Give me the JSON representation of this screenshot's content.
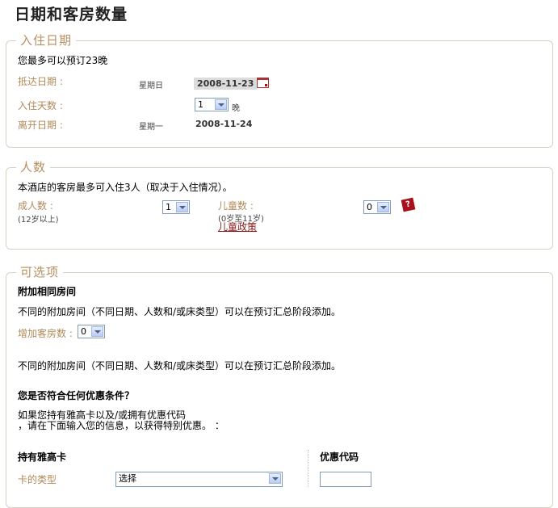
{
  "page_title": "日期和客房数量",
  "checkin": {
    "legend": "入住日期",
    "max_nights_note": "您最多可以预订23晚",
    "arrival_label": "抵达日期 :",
    "arrival_weekday": "星期日",
    "arrival_date": "2008-11-23",
    "nights_label": "入住天数 :",
    "nights_value": "1",
    "nights_unit": "晚",
    "departure_label": "离开日期 :",
    "departure_weekday": "星期一",
    "departure_date": "2008-11-24"
  },
  "guests": {
    "legend": "人数",
    "max_note": "本酒店的客房最多可入住3人（取决于入住情况）。",
    "adults_label": "成人数 :",
    "adults_hint": "(12岁以上)",
    "adults_value": "1",
    "children_label": "儿童数 :",
    "children_hint": "(0岁至11岁)",
    "children_policy": "儿童政策",
    "children_value": "0",
    "help_glyph": "?"
  },
  "options": {
    "legend": "可选项",
    "extra_rooms_title": "附加相同房间",
    "extra_rooms_note": "不同的附加房间（不同日期、人数和/或床类型）可以在预订汇总阶段添加。",
    "add_rooms_label": "增加客房数 :",
    "add_rooms_value": "0",
    "extra_rooms_note2": "不同的附加房间（不同日期、人数和/或床类型）可以在预订汇总阶段添加。",
    "discount_title": "您是否符合任何优惠条件？",
    "discount_line1": "如果您持有雅高卡以及/或拥有优惠代码",
    "discount_line2": "，请在下面输入您的信息，以获得特别优惠。  ：",
    "card_title": "持有雅高卡",
    "card_type_label": "卡的类型",
    "card_type_value": "选择",
    "promo_title": "优惠代码"
  },
  "colors": {
    "label": "#b08a58",
    "legend": "#b79060",
    "border": "#d8d1c3",
    "help": "#a8101c"
  }
}
